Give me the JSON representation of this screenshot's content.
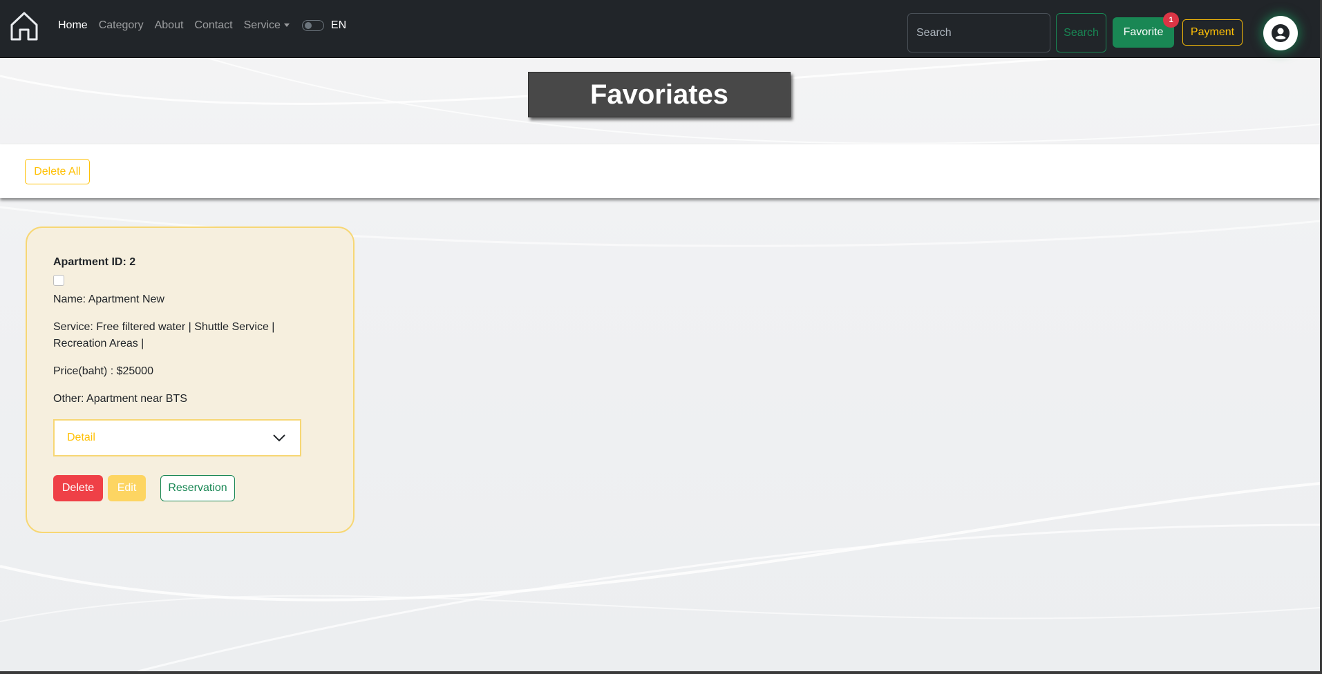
{
  "navbar": {
    "links": [
      "Home",
      "Category",
      "About",
      "Contact",
      "Service"
    ],
    "language": "EN",
    "search_placeholder": "Search",
    "search_button": "Search",
    "favorite_button": "Favorite",
    "favorite_count": "1",
    "payment_button": "Payment"
  },
  "page": {
    "title": "Favoriates",
    "delete_all_button": "Delete All"
  },
  "favorites": [
    {
      "apartment_id": "Apartment ID: 2",
      "name": "Name: Apartment New",
      "service": "Service: Free filtered water | Shuttle Service | Recreation Areas |",
      "price": "Price(baht) : $25000",
      "other": "Other: Apartment near BTS",
      "detail_label": "Detail",
      "delete_button": "Delete",
      "edit_button": "Edit",
      "reservation_button": "Reservation"
    }
  ],
  "colors": {
    "navbar_bg": "#212529",
    "success": "#198754",
    "warning": "#ffc107",
    "danger": "#dc3545",
    "card_bg": "#f6efde"
  }
}
